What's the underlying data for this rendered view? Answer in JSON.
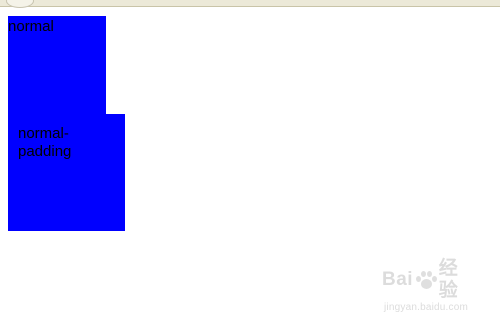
{
  "page": {
    "boxes": [
      {
        "label": "normal",
        "color": "#0000ff"
      },
      {
        "label": "normal-padding",
        "color": "#0000ff"
      }
    ]
  },
  "watermark": {
    "brand_left": "Bai",
    "brand_icon": "paw-icon",
    "brand_right": "经验",
    "url": "jingyan.baidu.com"
  },
  "chrome": {
    "background": "#ece9d8"
  }
}
